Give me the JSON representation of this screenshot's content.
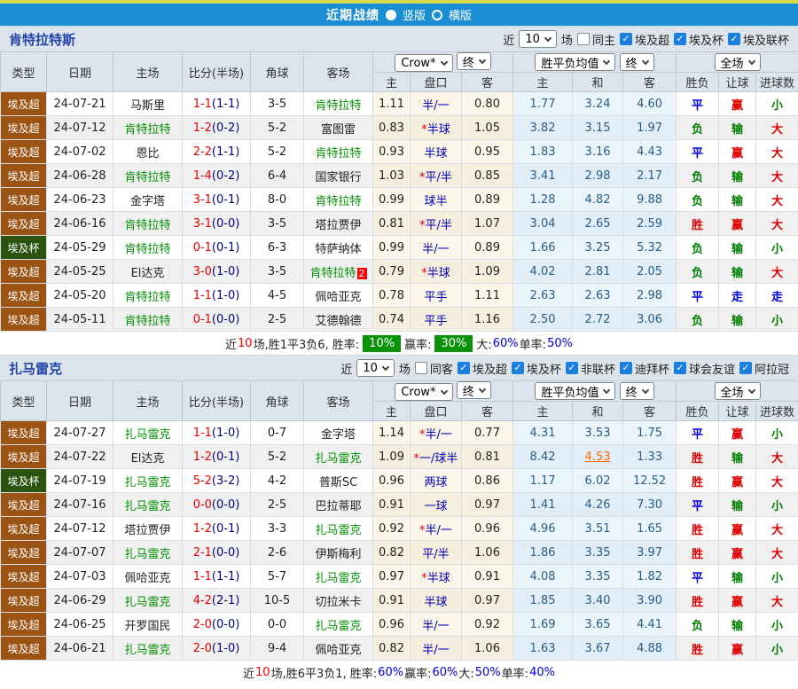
{
  "topbar": {
    "title": "近期战绩",
    "view_options": [
      {
        "label": "竖版",
        "selected": true
      },
      {
        "label": "横版",
        "selected": false
      }
    ]
  },
  "colors": {
    "accent_blue": "#1b8fd4",
    "leagues": {
      "埃及超": "#9c5414",
      "埃及杯": "#2a5410"
    },
    "focus_team_green": "#009000",
    "score_red": "#ea0000",
    "halftime_navy": "#000080",
    "handicap_navy": "#0000b4",
    "avg_steel_blue": "#2a5d87",
    "hot_orange": "#ff6600",
    "summary_green_box": "#0a930a"
  },
  "table_header": {
    "cols": [
      "类型",
      "日期",
      "主场",
      "比分(半场)",
      "角球",
      "客场"
    ],
    "odds": [
      "主",
      "盘口",
      "客"
    ],
    "avg": [
      "主",
      "和",
      "客"
    ],
    "result": [
      "胜负",
      "让球",
      "进球数"
    ],
    "selects": {
      "bookmaker": "Crow*",
      "final": "终",
      "avg": "胜平负均值",
      "scope": "全场"
    }
  },
  "sections": [
    {
      "team": "肯特拉特斯",
      "filter": {
        "near_label": "近",
        "count": "10",
        "games_label": "场",
        "same_label": "同主",
        "same_checked": false,
        "competitions": [
          "埃及超",
          "埃及杯",
          "埃及联杯"
        ]
      },
      "rows": [
        {
          "lg": "埃及超",
          "dt": "24-07-21",
          "hm": "马斯里",
          "hf": 0,
          "sc": "1-1",
          "ht": "(1-1)",
          "cn": "3-5",
          "aw": "肯特拉特",
          "af": 1,
          "bd": "",
          "oh": "1.11",
          "st": 0,
          "hc": "半/一",
          "oa": "0.80",
          "mh": "1.77",
          "md": "3.24",
          "ma": "4.60",
          "hot": 0,
          "r": [
            "平",
            "赢",
            "小"
          ]
        },
        {
          "lg": "埃及超",
          "dt": "24-07-12",
          "hm": "肯特拉特",
          "hf": 1,
          "sc": "1-2",
          "ht": "(0-2)",
          "cn": "5-2",
          "aw": "富图雷",
          "af": 0,
          "bd": "",
          "oh": "0.83",
          "st": 1,
          "hc": "半球",
          "oa": "1.05",
          "mh": "3.82",
          "md": "3.15",
          "ma": "1.97",
          "hot": 0,
          "r": [
            "负",
            "输",
            "大"
          ]
        },
        {
          "lg": "埃及超",
          "dt": "24-07-02",
          "hm": "恩比",
          "hf": 0,
          "sc": "2-2",
          "ht": "(1-1)",
          "cn": "5-2",
          "aw": "肯特拉特",
          "af": 1,
          "bd": "",
          "oh": "0.93",
          "st": 0,
          "hc": "半球",
          "oa": "0.95",
          "mh": "1.83",
          "md": "3.16",
          "ma": "4.43",
          "hot": 0,
          "r": [
            "平",
            "赢",
            "大"
          ]
        },
        {
          "lg": "埃及超",
          "dt": "24-06-28",
          "hm": "肯特拉特",
          "hf": 1,
          "sc": "1-4",
          "ht": "(0-2)",
          "cn": "6-4",
          "aw": "国家银行",
          "af": 0,
          "bd": "",
          "oh": "1.03",
          "st": 1,
          "hc": "平/半",
          "oa": "0.85",
          "mh": "3.41",
          "md": "2.98",
          "ma": "2.17",
          "hot": 0,
          "r": [
            "负",
            "输",
            "大"
          ]
        },
        {
          "lg": "埃及超",
          "dt": "24-06-23",
          "hm": "金字塔",
          "hf": 0,
          "sc": "3-1",
          "ht": "(0-1)",
          "cn": "8-0",
          "aw": "肯特拉特",
          "af": 1,
          "bd": "",
          "oh": "0.99",
          "st": 0,
          "hc": "球半",
          "oa": "0.89",
          "mh": "1.28",
          "md": "4.82",
          "ma": "9.88",
          "hot": 0,
          "r": [
            "负",
            "输",
            "大"
          ]
        },
        {
          "lg": "埃及超",
          "dt": "24-06-16",
          "hm": "肯特拉特",
          "hf": 1,
          "sc": "3-1",
          "ht": "(0-0)",
          "cn": "3-5",
          "aw": "塔拉贾伊",
          "af": 0,
          "bd": "",
          "oh": "0.81",
          "st": 1,
          "hc": "平/半",
          "oa": "1.07",
          "mh": "3.04",
          "md": "2.65",
          "ma": "2.59",
          "hot": 0,
          "r": [
            "胜",
            "赢",
            "大"
          ]
        },
        {
          "lg": "埃及杯",
          "dt": "24-05-29",
          "hm": "肯特拉特",
          "hf": 1,
          "sc": "0-1",
          "ht": "(0-1)",
          "cn": "6-3",
          "aw": "特萨纳体",
          "af": 0,
          "bd": "",
          "oh": "0.99",
          "st": 0,
          "hc": "半/一",
          "oa": "0.89",
          "mh": "1.66",
          "md": "3.25",
          "ma": "5.32",
          "hot": 0,
          "r": [
            "负",
            "输",
            "小"
          ]
        },
        {
          "lg": "埃及超",
          "dt": "24-05-25",
          "hm": "El达克",
          "hf": 0,
          "sc": "3-0",
          "ht": "(1-0)",
          "cn": "3-5",
          "aw": "肯特拉特",
          "af": 1,
          "bd": "2",
          "oh": "0.79",
          "st": 1,
          "hc": "半球",
          "oa": "1.09",
          "mh": "4.02",
          "md": "2.81",
          "ma": "2.05",
          "hot": 0,
          "r": [
            "负",
            "输",
            "大"
          ]
        },
        {
          "lg": "埃及超",
          "dt": "24-05-20",
          "hm": "肯特拉特",
          "hf": 1,
          "sc": "1-1",
          "ht": "(1-0)",
          "cn": "4-5",
          "aw": "佩哈亚克",
          "af": 0,
          "bd": "",
          "oh": "0.78",
          "st": 0,
          "hc": "平手",
          "oa": "1.11",
          "mh": "2.63",
          "md": "2.63",
          "ma": "2.98",
          "hot": 0,
          "r": [
            "平",
            "走",
            "走"
          ]
        },
        {
          "lg": "埃及超",
          "dt": "24-05-11",
          "hm": "肯特拉特",
          "hf": 1,
          "sc": "0-1",
          "ht": "(0-0)",
          "cn": "2-5",
          "aw": "艾德翰德",
          "af": 0,
          "bd": "",
          "oh": "0.74",
          "st": 0,
          "hc": "平手",
          "oa": "1.16",
          "mh": "2.50",
          "md": "2.72",
          "ma": "3.06",
          "hot": 0,
          "r": [
            "负",
            "输",
            "小"
          ]
        }
      ],
      "summary": [
        {
          "t": "近"
        },
        {
          "t": "10",
          "c": "red"
        },
        {
          "t": "场,胜1平3负6, 胜率:"
        },
        {
          "t": "10%",
          "c": "greenbox"
        },
        {
          "t": " 赢率:"
        },
        {
          "t": "30%",
          "c": "greenbox"
        },
        {
          "t": " 大:"
        },
        {
          "t": "60%",
          "c": "blue"
        },
        {
          "t": " 单率:"
        },
        {
          "t": "50%",
          "c": "blue"
        }
      ]
    },
    {
      "team": "扎马雷克",
      "filter": {
        "near_label": "近",
        "count": "10",
        "games_label": "场",
        "same_label": "同客",
        "same_checked": false,
        "competitions": [
          "埃及超",
          "埃及杯",
          "非联杯",
          "迪拜杯",
          "球会友谊",
          "阿拉冠"
        ]
      },
      "rows": [
        {
          "lg": "埃及超",
          "dt": "24-07-27",
          "hm": "扎马雷克",
          "hf": 1,
          "sc": "1-1",
          "ht": "(1-0)",
          "cn": "0-7",
          "aw": "金字塔",
          "af": 0,
          "bd": "",
          "oh": "1.14",
          "st": 1,
          "hc": "半/一",
          "oa": "0.77",
          "mh": "4.31",
          "md": "3.53",
          "ma": "1.75",
          "hot": 0,
          "r": [
            "平",
            "赢",
            "小"
          ]
        },
        {
          "lg": "埃及超",
          "dt": "24-07-22",
          "hm": "El达克",
          "hf": 0,
          "sc": "1-2",
          "ht": "(0-1)",
          "cn": "5-2",
          "aw": "扎马雷克",
          "af": 1,
          "bd": "",
          "oh": "1.09",
          "st": 1,
          "hc": "一/球半",
          "oa": "0.81",
          "mh": "8.42",
          "md": "4.53",
          "ma": "1.33",
          "hot": 1,
          "r": [
            "胜",
            "输",
            "大"
          ]
        },
        {
          "lg": "埃及杯",
          "dt": "24-07-19",
          "hm": "扎马雷克",
          "hf": 1,
          "sc": "5-2",
          "ht": "(3-2)",
          "cn": "4-2",
          "aw": "普斯SC",
          "af": 0,
          "bd": "",
          "oh": "0.96",
          "st": 0,
          "hc": "两球",
          "oa": "0.86",
          "mh": "1.17",
          "md": "6.02",
          "ma": "12.52",
          "hot": 0,
          "r": [
            "胜",
            "赢",
            "大"
          ]
        },
        {
          "lg": "埃及超",
          "dt": "24-07-16",
          "hm": "扎马雷克",
          "hf": 1,
          "sc": "0-0",
          "ht": "(0-0)",
          "cn": "2-5",
          "aw": "巴拉蒂耶",
          "af": 0,
          "bd": "",
          "oh": "0.91",
          "st": 0,
          "hc": "一球",
          "oa": "0.97",
          "mh": "1.41",
          "md": "4.26",
          "ma": "7.30",
          "hot": 0,
          "r": [
            "平",
            "输",
            "小"
          ]
        },
        {
          "lg": "埃及超",
          "dt": "24-07-12",
          "hm": "塔拉贾伊",
          "hf": 0,
          "sc": "1-2",
          "ht": "(0-1)",
          "cn": "3-3",
          "aw": "扎马雷克",
          "af": 1,
          "bd": "",
          "oh": "0.92",
          "st": 1,
          "hc": "半/一",
          "oa": "0.96",
          "mh": "4.96",
          "md": "3.51",
          "ma": "1.65",
          "hot": 0,
          "r": [
            "胜",
            "赢",
            "大"
          ]
        },
        {
          "lg": "埃及超",
          "dt": "24-07-07",
          "hm": "扎马雷克",
          "hf": 1,
          "sc": "2-1",
          "ht": "(0-0)",
          "cn": "2-6",
          "aw": "伊斯梅利",
          "af": 0,
          "bd": "",
          "oh": "0.82",
          "st": 0,
          "hc": "平/半",
          "oa": "1.06",
          "mh": "1.86",
          "md": "3.35",
          "ma": "3.97",
          "hot": 0,
          "r": [
            "胜",
            "赢",
            "大"
          ]
        },
        {
          "lg": "埃及超",
          "dt": "24-07-03",
          "hm": "佩哈亚克",
          "hf": 0,
          "sc": "1-1",
          "ht": "(1-1)",
          "cn": "5-7",
          "aw": "扎马雷克",
          "af": 1,
          "bd": "",
          "oh": "0.97",
          "st": 1,
          "hc": "半球",
          "oa": "0.91",
          "mh": "4.08",
          "md": "3.35",
          "ma": "1.82",
          "hot": 0,
          "r": [
            "平",
            "输",
            "小"
          ]
        },
        {
          "lg": "埃及超",
          "dt": "24-06-29",
          "hm": "扎马雷克",
          "hf": 1,
          "sc": "4-2",
          "ht": "(2-1)",
          "cn": "10-5",
          "aw": "切拉米卡",
          "af": 0,
          "bd": "",
          "oh": "0.91",
          "st": 0,
          "hc": "半球",
          "oa": "0.97",
          "mh": "1.85",
          "md": "3.40",
          "ma": "3.90",
          "hot": 0,
          "r": [
            "胜",
            "赢",
            "大"
          ]
        },
        {
          "lg": "埃及超",
          "dt": "24-06-25",
          "hm": "开罗国民",
          "hf": 0,
          "sc": "2-0",
          "ht": "(0-0)",
          "cn": "0-0",
          "aw": "扎马雷克",
          "af": 1,
          "bd": "",
          "oh": "0.96",
          "st": 0,
          "hc": "半/一",
          "oa": "0.92",
          "mh": "1.69",
          "md": "3.65",
          "ma": "4.41",
          "hot": 0,
          "r": [
            "负",
            "输",
            "小"
          ]
        },
        {
          "lg": "埃及超",
          "dt": "24-06-21",
          "hm": "扎马雷克",
          "hf": 1,
          "sc": "2-0",
          "ht": "(1-0)",
          "cn": "9-4",
          "aw": "佩哈亚克",
          "af": 0,
          "bd": "",
          "oh": "0.82",
          "st": 0,
          "hc": "半/一",
          "oa": "1.06",
          "mh": "1.63",
          "md": "3.67",
          "ma": "4.88",
          "hot": 0,
          "r": [
            "胜",
            "赢",
            "小"
          ]
        }
      ],
      "summary": [
        {
          "t": "近"
        },
        {
          "t": "10",
          "c": "red"
        },
        {
          "t": "场,胜6平3负1, 胜率:"
        },
        {
          "t": "60%",
          "c": "blue"
        },
        {
          "t": " 赢率:"
        },
        {
          "t": "60%",
          "c": "blue"
        },
        {
          "t": " 大:"
        },
        {
          "t": "50%",
          "c": "blue"
        },
        {
          "t": " 单率:"
        },
        {
          "t": "40%",
          "c": "blue"
        }
      ]
    }
  ]
}
